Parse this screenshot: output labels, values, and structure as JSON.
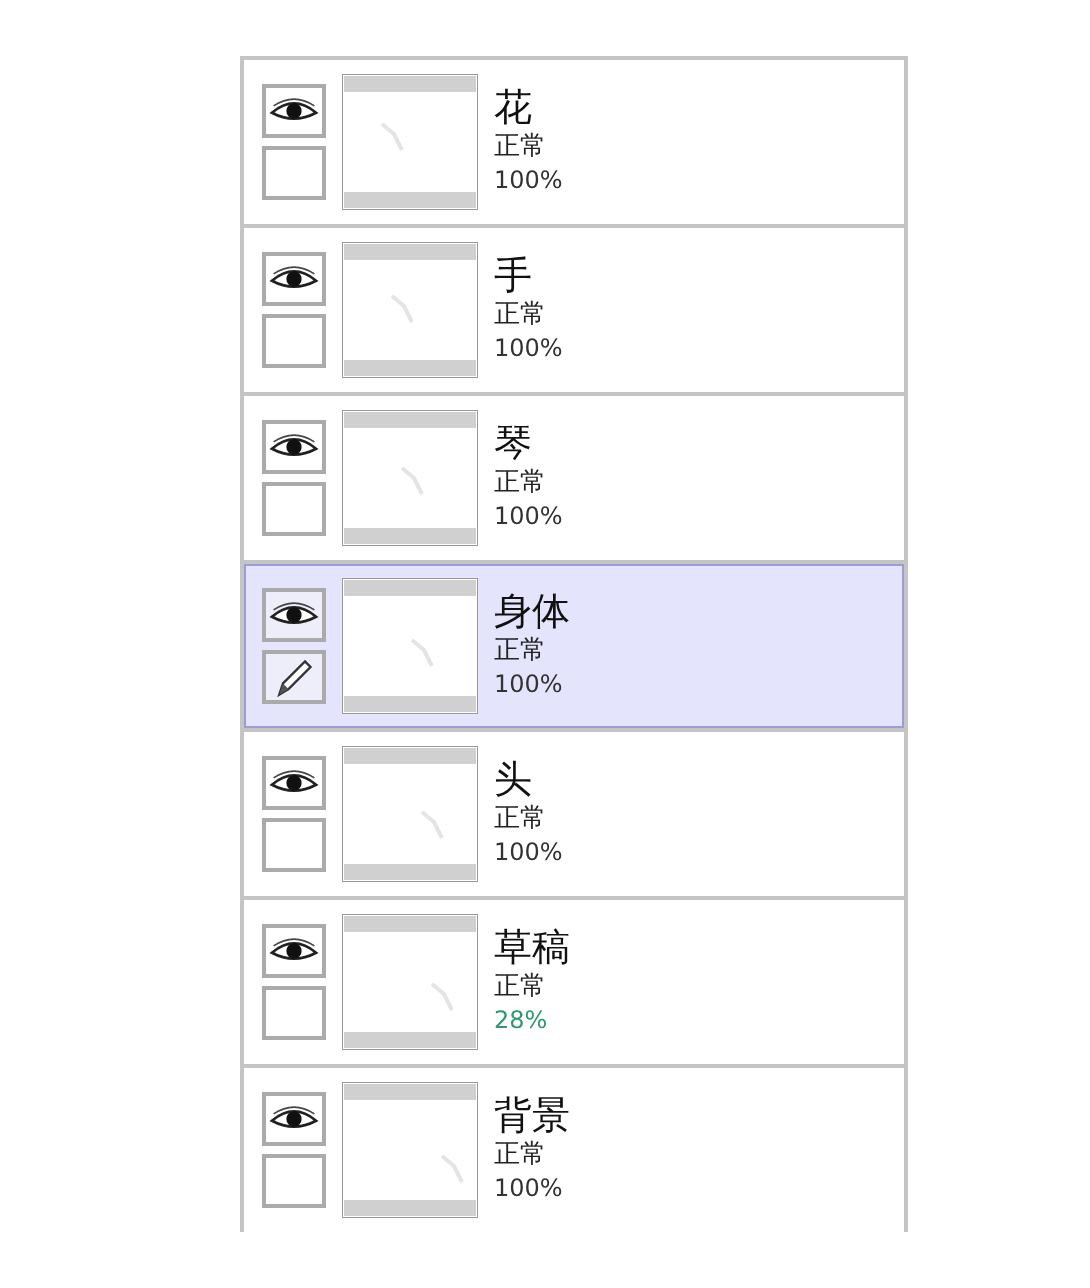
{
  "layers": [
    {
      "name": "花",
      "mode": "正常",
      "opacity": "100%",
      "reduced_opacity": false,
      "visible": true,
      "selected": false,
      "editing": false
    },
    {
      "name": "手",
      "mode": "正常",
      "opacity": "100%",
      "reduced_opacity": false,
      "visible": true,
      "selected": false,
      "editing": false
    },
    {
      "name": "琴",
      "mode": "正常",
      "opacity": "100%",
      "reduced_opacity": false,
      "visible": true,
      "selected": false,
      "editing": false
    },
    {
      "name": "身体",
      "mode": "正常",
      "opacity": "100%",
      "reduced_opacity": false,
      "visible": true,
      "selected": true,
      "editing": true
    },
    {
      "name": "头",
      "mode": "正常",
      "opacity": "100%",
      "reduced_opacity": false,
      "visible": true,
      "selected": false,
      "editing": false
    },
    {
      "name": "草稿",
      "mode": "正常",
      "opacity": "28%",
      "reduced_opacity": true,
      "visible": true,
      "selected": false,
      "editing": false
    },
    {
      "name": "背景",
      "mode": "正常",
      "opacity": "100%",
      "reduced_opacity": false,
      "visible": true,
      "selected": false,
      "editing": false
    }
  ]
}
